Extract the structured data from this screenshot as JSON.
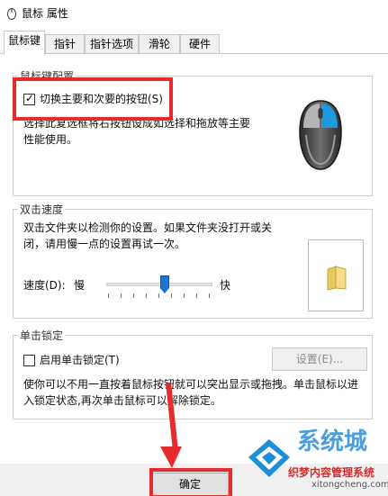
{
  "window": {
    "title": "鼠标 属性"
  },
  "tabs": [
    "鼠标键",
    "指针",
    "指针选项",
    "滑轮",
    "硬件"
  ],
  "button_config": {
    "group_title": "鼠标键配置",
    "checkbox_label": "切换主要和次要的按钮(S)",
    "checked": true,
    "description": [
      "选择此复选框将右按钮设成如选择和拖放等主要",
      "性能使用。"
    ]
  },
  "double_click": {
    "group_title": "双击速度",
    "description": [
      "双击文件夹以检测你的设置。如果文件夹没打开或关",
      "闭，请用慢一点的设置再试一次。"
    ],
    "speed_label": "速度(D):",
    "slow_label": "慢",
    "fast_label": "快",
    "speed_fraction": 0.55
  },
  "click_lock": {
    "group_title": "单击锁定",
    "checkbox_label": "启用单击锁定(T)",
    "checked": false,
    "settings_button": "设置(E)...",
    "description": [
      "使你可以不用一直按着鼠标按钮就可以突出显示或拖拽。单击鼠标以进",
      "入锁定状态,再次单击鼠标可以解除锁定。"
    ]
  },
  "footer": {
    "ok_button": "确定"
  },
  "watermark": {
    "brand": "系统城",
    "site": "织梦内容管理系统",
    "url": "xitongcheng.com"
  },
  "colors": {
    "highlight": "#e52b2b",
    "accent": "#1e72d0"
  }
}
